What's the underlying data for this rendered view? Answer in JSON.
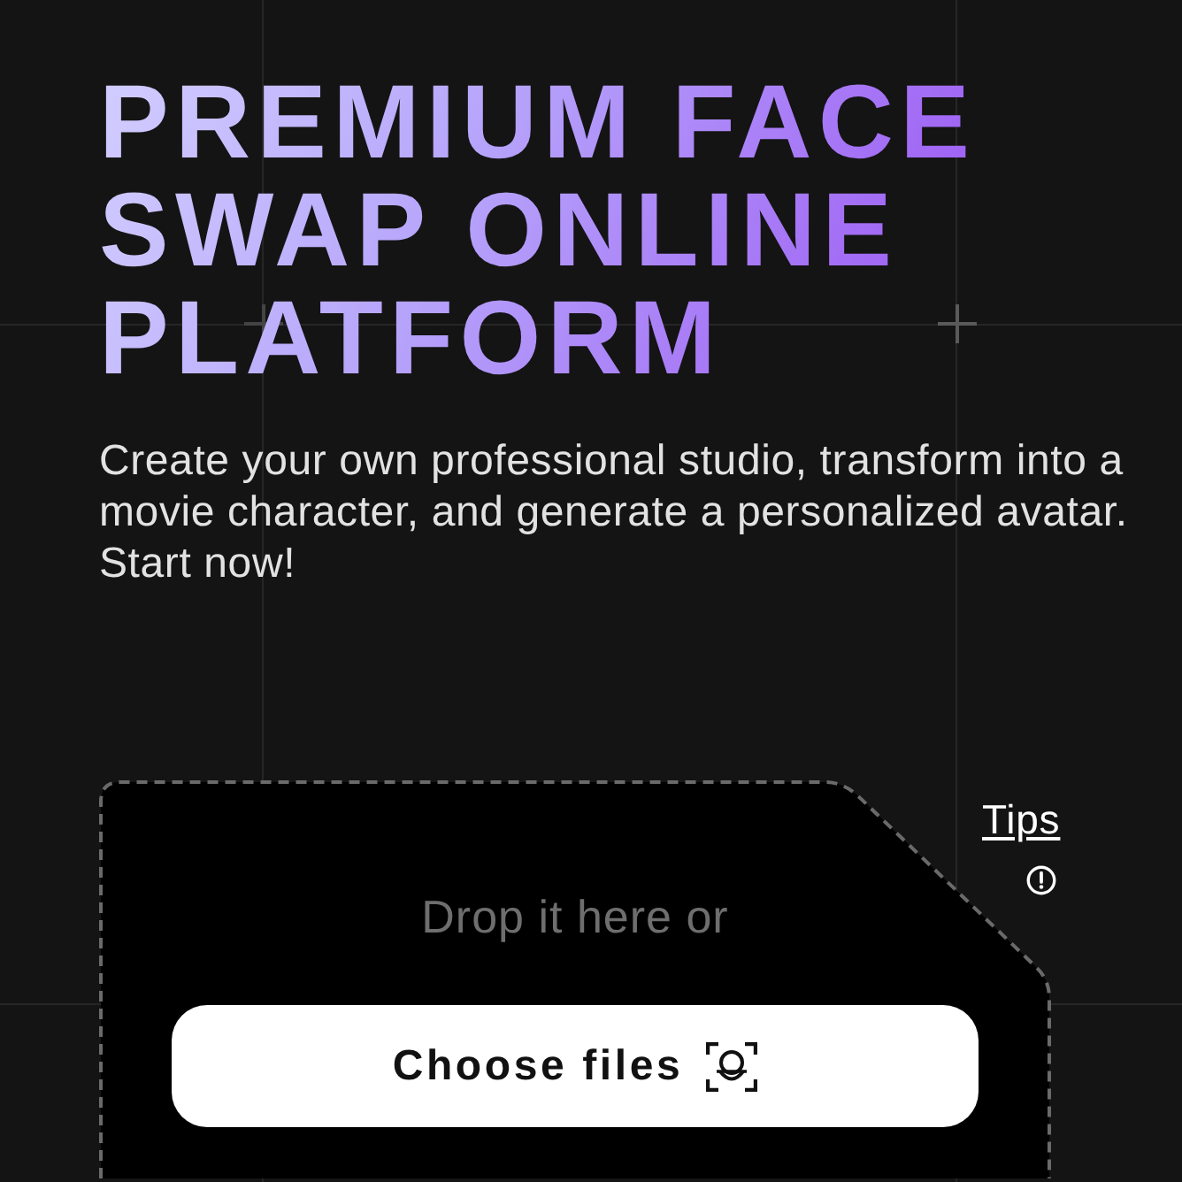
{
  "hero": {
    "title": "PREMIUM FACE SWAP ONLINE PLATFORM",
    "subtitle": "Create your own professional studio, transform into a movie character, and generate a personalized avatar. Start now!"
  },
  "upload": {
    "prompt": "Drop it here or",
    "button": "Choose files",
    "tips_link": "Tips"
  }
}
